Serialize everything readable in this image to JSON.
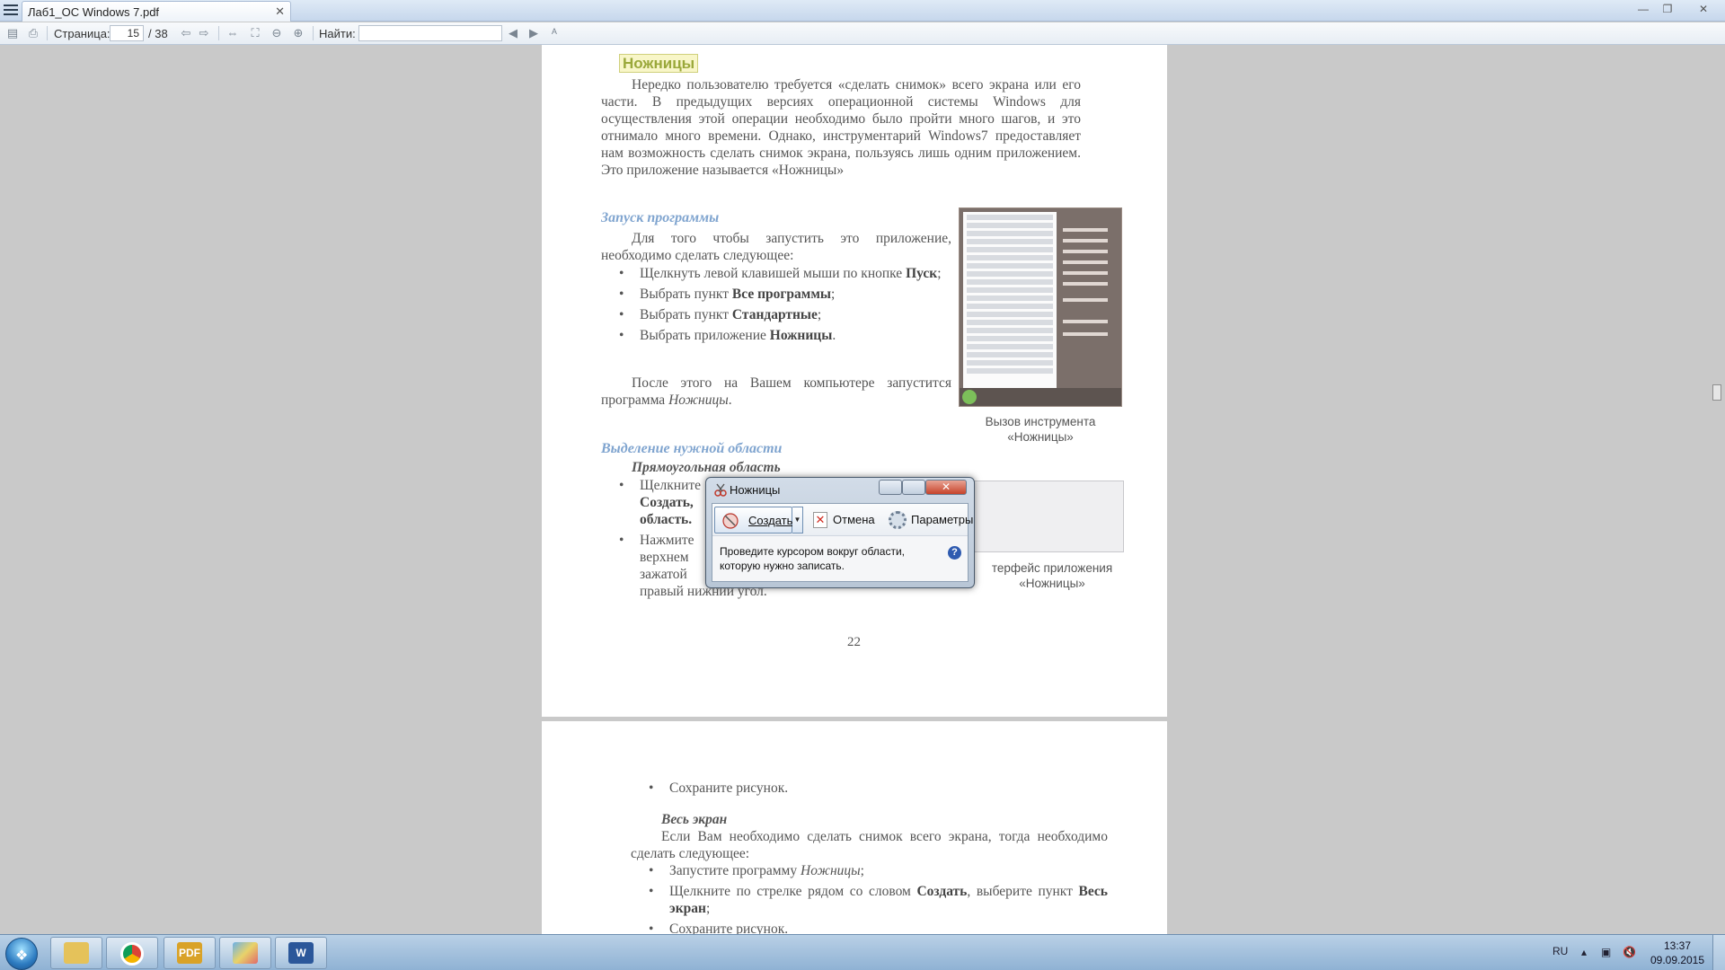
{
  "window": {
    "tab_title": "Лаб1_ОС Windows 7.pdf",
    "close_glyph": "✕",
    "controls": {
      "minimize": "—",
      "restore": "❐",
      "close": "✕"
    }
  },
  "toolbar": {
    "page_label": "Страница:",
    "page_current": "15",
    "page_total": "/ 38",
    "find_label": "Найти:",
    "find_value": ""
  },
  "page1": {
    "heading": "Ножницы",
    "intro": "Нередко пользователю требуется «сделать снимок» всего экрана или его части. В предыдущих версиях операционной системы Windows для осуществления этой операции необходимо было пройти много шагов, и это отнимало много времени. Однако, инструментарий Windows7 предоставляет нам возможность сделать снимок экрана, пользуясь лишь одним приложением. Это приложение называется «Ножницы»",
    "launch_heading": "Запуск программы",
    "launch_intro": "Для того чтобы запустить это приложение, необходимо сделать следующее:",
    "launch_steps": [
      "Щелкнуть левой клавишей мыши по кнопке Пуск;",
      "Выбрать пункт Все программы;",
      "Выбрать пункт Стандартные;",
      "Выбрать приложение Ножницы."
    ],
    "after_launch": "После этого на Вашем компьютере запустится программа Ножницы.",
    "caption1": "Вызов инструмента «Ножницы»",
    "select_heading": "Выделение нужной области",
    "rect_heading": "Прямоугольная область",
    "rect_step1_visible": "Щелкните",
    "rect_step1_bold1": "Создать,",
    "rect_step1_bold2": "область.",
    "rect_step2_visible": "Нажмите",
    "rect_step2_line2": "верхнем",
    "rect_step2_line3": "зажатой",
    "rect_step2_line4": "правый нижний угол.",
    "caption2": "терфейс приложения «Ножницы»",
    "page_number": "22"
  },
  "page2": {
    "save_step": "Сохраните рисунок.",
    "fullscreen_heading": "Весь экран",
    "fullscreen_intro": "Если Вам необходимо сделать снимок всего экрана, тогда необходимо сделать следующее:",
    "fullscreen_steps": [
      "Запустите программу Ножницы;",
      "Щелкните по стрелке рядом со словом Создать, выберите пункт Весь экран;",
      "Сохраните рисунок."
    ]
  },
  "snipping_tool": {
    "title": "Ножницы",
    "create_label": "Создать",
    "cancel_label": "Отмена",
    "options_label": "Параметры",
    "hint": "Проведите курсором вокруг области, которую нужно записать.",
    "help_glyph": "?"
  },
  "taskbar": {
    "apps": [
      "explorer",
      "chrome",
      "pdf-reader",
      "paint",
      "word"
    ],
    "pdf_label": "PDF",
    "word_label": "W",
    "language": "RU",
    "time": "13:37",
    "date": "09.09.2015"
  }
}
